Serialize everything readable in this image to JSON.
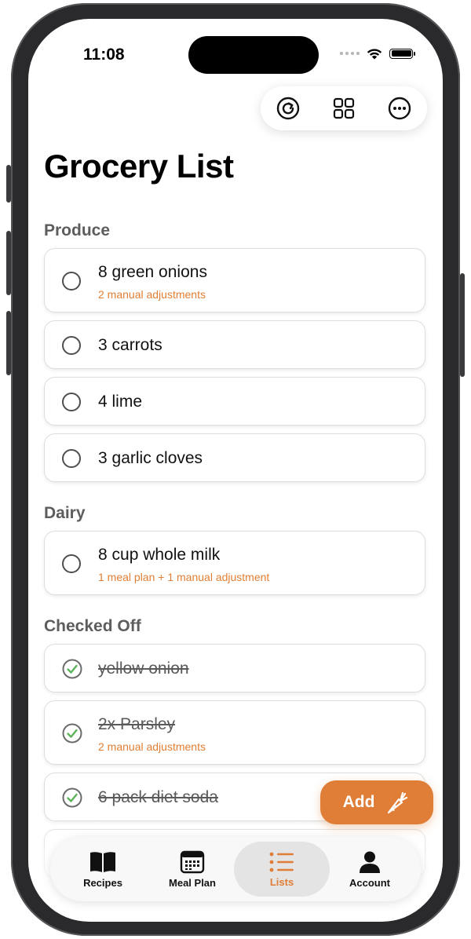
{
  "status_bar": {
    "time": "11:08"
  },
  "toolbar": {
    "refresh_icon": "refresh-circle-icon",
    "grid_icon": "grid-icon",
    "more_icon": "ellipsis-circle-icon"
  },
  "page": {
    "title": "Grocery List"
  },
  "sections": {
    "produce": {
      "title": "Produce",
      "items": [
        {
          "text": "8 green onions",
          "sub": "2 manual adjustments"
        },
        {
          "text": "3 carrots"
        },
        {
          "text": "4 lime"
        },
        {
          "text": "3 garlic cloves"
        }
      ]
    },
    "dairy": {
      "title": "Dairy",
      "items": [
        {
          "text": "8 cup whole milk",
          "sub": "1 meal plan + 1 manual adjustment"
        }
      ]
    },
    "checked": {
      "title": "Checked Off",
      "items": [
        {
          "text": "yellow onion"
        },
        {
          "text": "2x Parsley",
          "sub": "2 manual adjustments"
        },
        {
          "text": "6 pack diet soda"
        }
      ]
    }
  },
  "add_button": {
    "label": "Add",
    "icon": "carrot-icon"
  },
  "tabs": [
    {
      "label": "Recipes",
      "icon": "book-icon"
    },
    {
      "label": "Meal Plan",
      "icon": "calendar-icon"
    },
    {
      "label": "Lists",
      "icon": "list-icon",
      "active": true
    },
    {
      "label": "Account",
      "icon": "person-icon"
    }
  ],
  "colors": {
    "accent": "#e07d36",
    "check": "#5cb35c",
    "section_title": "#5d5d5d"
  }
}
